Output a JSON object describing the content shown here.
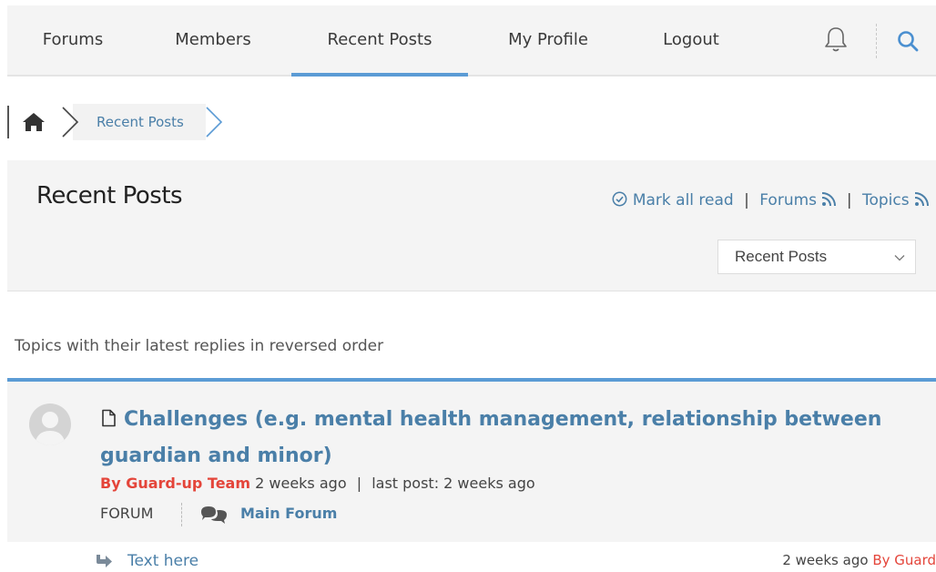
{
  "nav": {
    "items": [
      {
        "label": "Forums"
      },
      {
        "label": "Members"
      },
      {
        "label": "Recent Posts",
        "active": true
      },
      {
        "label": "My Profile"
      },
      {
        "label": "Logout"
      }
    ],
    "icons": [
      "bell-icon",
      "search-icon"
    ]
  },
  "breadcrumb": {
    "home_icon": "home-icon",
    "current": "Recent Posts"
  },
  "header": {
    "title": "Recent Posts",
    "mark_all_read": "Mark all read",
    "forums_link": "Forums",
    "topics_link": "Topics",
    "separator": "|",
    "select_value": "Recent Posts"
  },
  "description": "Topics with their latest replies in reversed order",
  "topic": {
    "title": "Challenges (e.g. mental health management, relationship between guardian and minor)",
    "author_label": "By Guard-up Team",
    "time": "2 weeks ago",
    "last_post": "last post: 2 weeks ago",
    "forum_label": "FORUM",
    "forum_name": "Main Forum"
  },
  "reply": {
    "text": "Text here",
    "time": "2 weeks ago",
    "author": "By Guard"
  },
  "colors": {
    "accent": "#5b9bd5",
    "link": "#4a7fa8",
    "author": "#e4453a",
    "panel_bg": "#f4f4f4"
  }
}
